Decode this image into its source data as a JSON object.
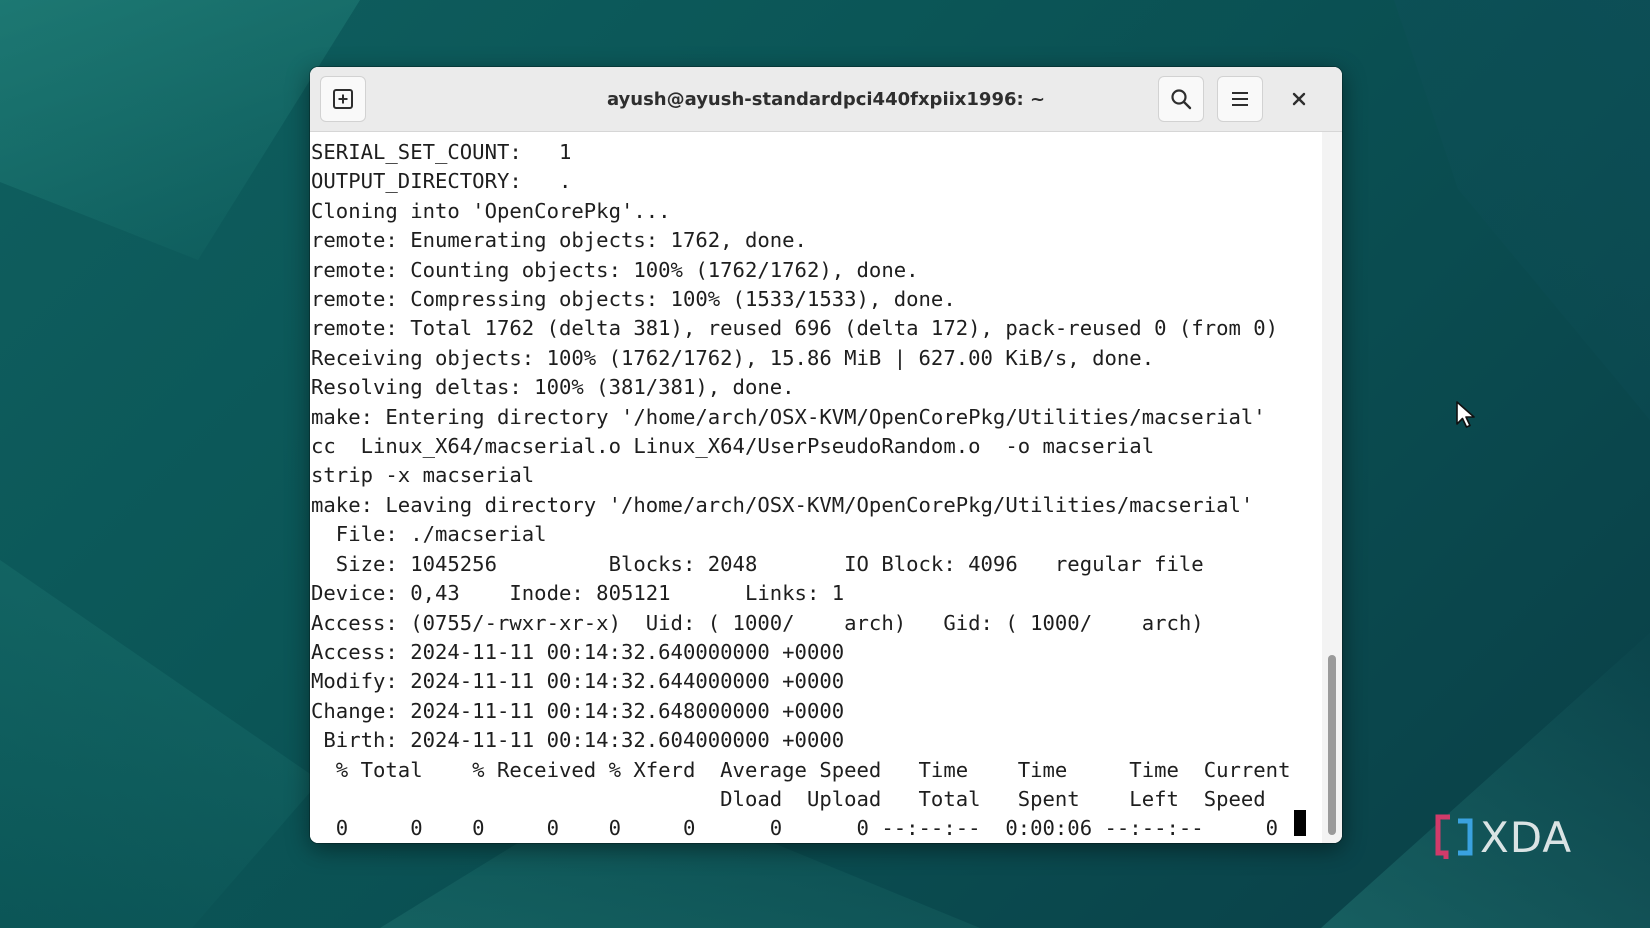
{
  "window": {
    "title": "ayush@ayush-standardpci440fxpiix1996: ~"
  },
  "icons": {
    "new_tab": "new-tab-icon",
    "search": "search-icon",
    "menu": "hamburger-menu-icon",
    "close": "close-icon"
  },
  "terminal": {
    "lines": [
      "SERIAL_SET_COUNT:   1",
      "OUTPUT_DIRECTORY:   .",
      "Cloning into 'OpenCorePkg'...",
      "remote: Enumerating objects: 1762, done.",
      "remote: Counting objects: 100% (1762/1762), done.",
      "remote: Compressing objects: 100% (1533/1533), done.",
      "remote: Total 1762 (delta 381), reused 696 (delta 172), pack-reused 0 (from 0)",
      "Receiving objects: 100% (1762/1762), 15.86 MiB | 627.00 KiB/s, done.",
      "Resolving deltas: 100% (381/381), done.",
      "make: Entering directory '/home/arch/OSX-KVM/OpenCorePkg/Utilities/macserial'",
      "cc  Linux_X64/macserial.o Linux_X64/UserPseudoRandom.o  -o macserial",
      "strip -x macserial",
      "make: Leaving directory '/home/arch/OSX-KVM/OpenCorePkg/Utilities/macserial'",
      "  File: ./macserial",
      "  Size: 1045256         Blocks: 2048       IO Block: 4096   regular file",
      "Device: 0,43    Inode: 805121      Links: 1",
      "Access: (0755/-rwxr-xr-x)  Uid: ( 1000/    arch)   Gid: ( 1000/    arch)",
      "Access: 2024-11-11 00:14:32.640000000 +0000",
      "Modify: 2024-11-11 00:14:32.644000000 +0000",
      "Change: 2024-11-11 00:14:32.648000000 +0000",
      " Birth: 2024-11-11 00:14:32.604000000 +0000",
      "  % Total    % Received % Xferd  Average Speed   Time    Time     Time  Current",
      "                                 Dload  Upload   Total   Spent    Left  Speed",
      "  0     0    0     0    0     0      0      0 --:--:--  0:00:06 --:--:--     0"
    ]
  },
  "colors": {
    "terminal_bg": "#ffffff",
    "terminal_fg": "#1e1e1e",
    "titlebar_bg": "#ebebeb"
  },
  "watermark": {
    "brand": "XDA"
  }
}
